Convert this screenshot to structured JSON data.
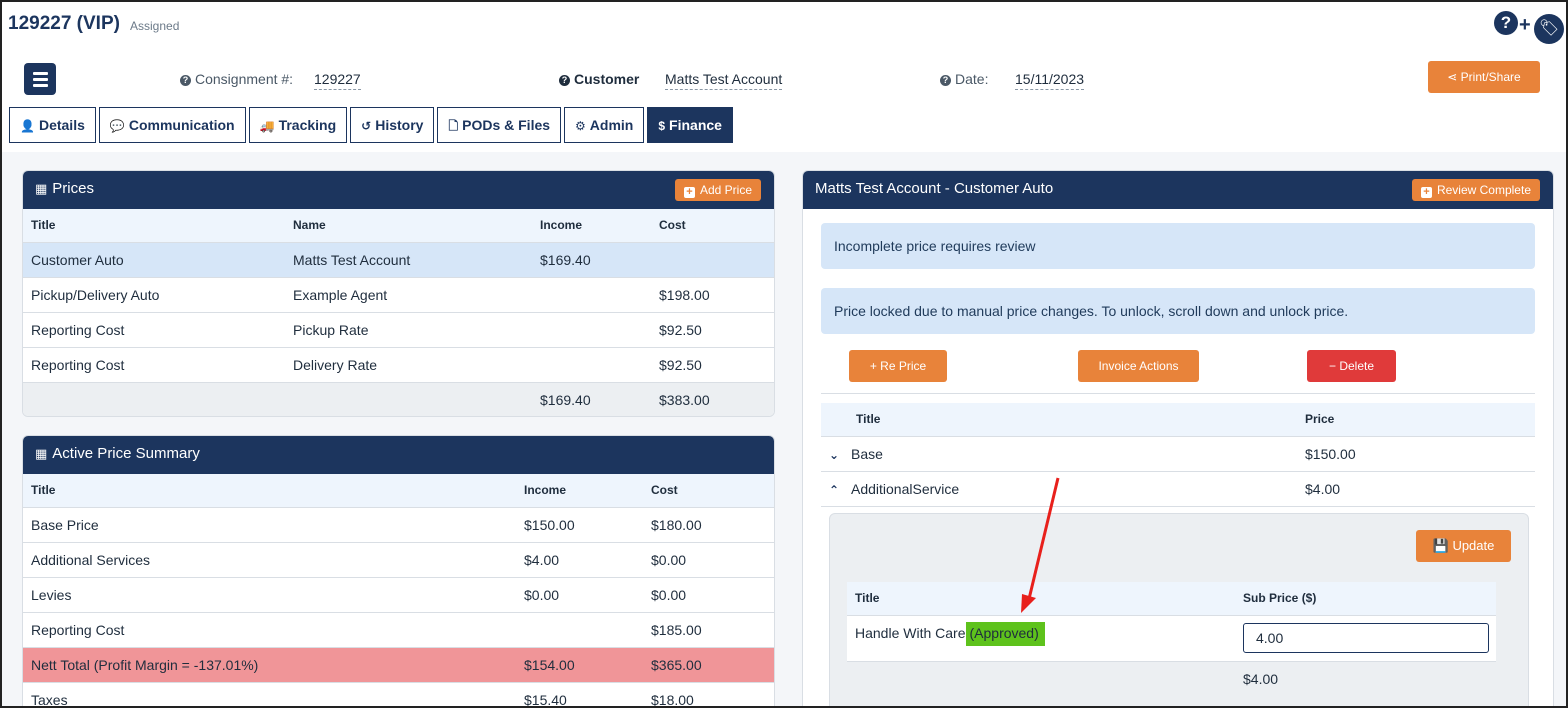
{
  "header": {
    "job_title": "129227 (VIP)",
    "status": "Assigned",
    "help_icon": "question-circle-icon",
    "add_icon": "plus-icon",
    "tag_icon": "tag-icon"
  },
  "meta": {
    "consignment_label": "Consignment #:",
    "consignment_value": "129227",
    "customer_label": "Customer",
    "customer_value": "Matts Test Account",
    "date_label": "Date:",
    "date_value": "15/11/2023",
    "print_label": "Print/Share"
  },
  "tabs": [
    {
      "label": "Details",
      "icon": "user-icon",
      "glyph": "👤"
    },
    {
      "label": "Communication",
      "icon": "comment-icon",
      "glyph": "💬"
    },
    {
      "label": "Tracking",
      "icon": "truck-icon",
      "glyph": "🚚"
    },
    {
      "label": "History",
      "icon": "history-icon",
      "glyph": "↺"
    },
    {
      "label": "PODs & Files",
      "icon": "file-icon",
      "glyph": "🗋"
    },
    {
      "label": "Admin",
      "icon": "gear-icon",
      "glyph": "⚙"
    },
    {
      "label": "Finance",
      "icon": "dollar-icon",
      "glyph": "$"
    }
  ],
  "prices": {
    "title": "Prices",
    "add_label": "Add Price",
    "columns": [
      "Title",
      "Name",
      "Income",
      "Cost"
    ],
    "rows": [
      [
        "Customer Auto",
        "Matts Test Account",
        "$169.40",
        ""
      ],
      [
        "Pickup/Delivery Auto",
        "Example Agent",
        "",
        "$198.00"
      ],
      [
        "Reporting Cost",
        "Pickup Rate",
        "",
        "$92.50"
      ],
      [
        "Reporting Cost",
        "Delivery Rate",
        "",
        "$92.50"
      ]
    ],
    "total_income": "$169.40",
    "total_cost": "$383.00"
  },
  "summary": {
    "title": "Active Price Summary",
    "columns": [
      "Title",
      "Income",
      "Cost"
    ],
    "rows": [
      [
        "Base Price",
        "$150.00",
        "$180.00"
      ],
      [
        "Additional Services",
        "$4.00",
        "$0.00"
      ],
      [
        "Levies",
        "$0.00",
        "$0.00"
      ],
      [
        "Reporting Cost",
        "",
        "$185.00"
      ],
      [
        "Nett Total (Profit Margin = -137.01%)",
        "$154.00",
        "$365.00"
      ],
      [
        "Taxes",
        "$15.40",
        "$18.00"
      ]
    ]
  },
  "detail": {
    "title": "Matts Test Account - Customer Auto",
    "review_label": "Review Complete",
    "alert1": "Incomplete price requires review",
    "alert2": "Price locked due to manual price changes. To unlock, scroll down and unlock price.",
    "reprice_label": "Re Price",
    "invoice_label": "Invoice Actions",
    "delete_label": "Delete",
    "columns": [
      "Title",
      "Price"
    ],
    "rows": [
      {
        "title": "Base",
        "price": "$150.00",
        "expanded": false
      },
      {
        "title": "AdditionalService",
        "price": "$4.00",
        "expanded": true
      }
    ],
    "sub": {
      "update_label": "Update",
      "columns": [
        "Title",
        "Sub Price ($)"
      ],
      "item_title": "Handle With Care",
      "item_status": "(Approved)",
      "item_value": "4.00",
      "total": "$4.00"
    }
  },
  "colors": {
    "navy": "#1c355e",
    "orange": "#e8833a",
    "red": "#e03a3a",
    "highlight_blue": "#d6e6f8",
    "nett_red": "#f09598",
    "approved_green": "#5ec21c"
  }
}
